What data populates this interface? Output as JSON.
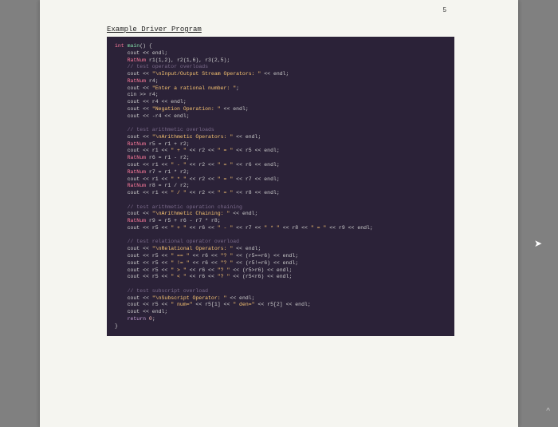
{
  "page_number": "5",
  "title": "Example Driver Program",
  "cursor_glyph": "➤",
  "caret_glyph": "^",
  "code": {
    "l01a": "int ",
    "l01b": "main",
    "l01c": "() {",
    "l02a": "    cout ",
    "l02b": "<<",
    "l02c": " endl;",
    "l03a": "    RatNum ",
    "l03b": "r1(1,2), r2(1,6), r3(2,5);",
    "l04": "    // test operator overloads",
    "l05a": "    cout ",
    "l05b": "<< ",
    "l05c": "\"\\nInput/Output Stream Operators: \"",
    "l05d": " << endl;",
    "l06a": "    RatNum ",
    "l06b": "r4;",
    "l07a": "    cout ",
    "l07b": "<< ",
    "l07c": "\"Enter a rational number: \"",
    "l07d": ";",
    "l08a": "    cin ",
    "l08b": ">> r4;",
    "l09a": "    cout ",
    "l09b": "<< r4 << endl;",
    "l10a": "    cout ",
    "l10b": "<< ",
    "l10c": "\"Negation Operation: \"",
    "l10d": " << endl;",
    "l11a": "    cout ",
    "l11b": "<< -r4 << endl;",
    "blank1": "",
    "l12": "    // test arithmetic overloads",
    "l13a": "    cout ",
    "l13b": "<< ",
    "l13c": "\"\\nArithmetic Operators: \"",
    "l13d": " << endl;",
    "l14a": "    RatNum ",
    "l14b": "r5 = r1 + r2;",
    "l15a": "    cout ",
    "l15b": "<< r1 << ",
    "l15c": "\" + \"",
    "l15d": " << r2 << ",
    "l15e": "\" = \"",
    "l15f": " << r5 << endl;",
    "l16a": "    RatNum ",
    "l16b": "r6 = r1 - r2;",
    "l17a": "    cout ",
    "l17b": "<< r1 << ",
    "l17c": "\" - \"",
    "l17d": " << r2 << ",
    "l17e": "\" = \"",
    "l17f": " << r6 << endl;",
    "l18a": "    RatNum ",
    "l18b": "r7 = r1 * r2;",
    "l19a": "    cout ",
    "l19b": "<< r1 << ",
    "l19c": "\" * \"",
    "l19d": " << r2 << ",
    "l19e": "\" = \"",
    "l19f": " << r7 << endl;",
    "l20a": "    RatNum ",
    "l20b": "r8 = r1 / r2;",
    "l21a": "    cout ",
    "l21b": "<< r1 << ",
    "l21c": "\" / \"",
    "l21d": " << r2 << ",
    "l21e": "\" = \"",
    "l21f": " << r8 << endl;",
    "blank2": "",
    "l22": "    // test arithmetic operation chaining",
    "l23a": "    cout ",
    "l23b": "<< ",
    "l23c": "\"\\nArithmetic Chaining: \"",
    "l23d": " << endl;",
    "l24a": "    RatNum ",
    "l24b": "r9 = r5 + r6 - r7 * r8;",
    "l25a": "    cout ",
    "l25b": "<< r5 << ",
    "l25c": "\" + \"",
    "l25d": " << r6 << ",
    "l25e": "\" - \"",
    "l25f": " << r7 << ",
    "l25g": "\" * \"",
    "l25h": " << r8 << ",
    "l25i": "\" = \"",
    "l25j": " << r9 << endl;",
    "blank3": "",
    "l26": "    // test relational operator overload",
    "l27a": "    cout ",
    "l27b": "<< ",
    "l27c": "\"\\nRelational Operators: \"",
    "l27d": " << endl;",
    "l28a": "    cout ",
    "l28b": "<< r5 << ",
    "l28c": "\" == \"",
    "l28d": " << r6 << ",
    "l28e": "\"? \"",
    "l28f": " << (r5==r6) << endl;",
    "l29a": "    cout ",
    "l29b": "<< r5 << ",
    "l29c": "\" != \"",
    "l29d": " << r6 << ",
    "l29e": "\"? \"",
    "l29f": " << (r5!=r6) << endl;",
    "l30a": "    cout ",
    "l30b": "<< r5 << ",
    "l30c": "\" > \"",
    "l30d": " << r6 << ",
    "l30e": "\"? \"",
    "l30f": " << (r5>r6) << endl;",
    "l31a": "    cout ",
    "l31b": "<< r5 << ",
    "l31c": "\" < \"",
    "l31d": " << r6 << ",
    "l31e": "\"? \"",
    "l31f": " << (r5<r6) << endl;",
    "blank4": "",
    "l32": "    // test subscript overload",
    "l33a": "    cout ",
    "l33b": "<< ",
    "l33c": "\"\\nSubscript Operator: \"",
    "l33d": " << endl;",
    "l34a": "    cout ",
    "l34b": "<< r5 << ",
    "l34c": "\" num=\"",
    "l34d": " << r5[1] << ",
    "l34e": "\" den=\"",
    "l34f": " << r5[2] << endl;",
    "l35a": "    cout ",
    "l35b": "<< endl;",
    "l36a": "    return ",
    "l36b": "0",
    "l36c": ";",
    "l37": "}"
  }
}
